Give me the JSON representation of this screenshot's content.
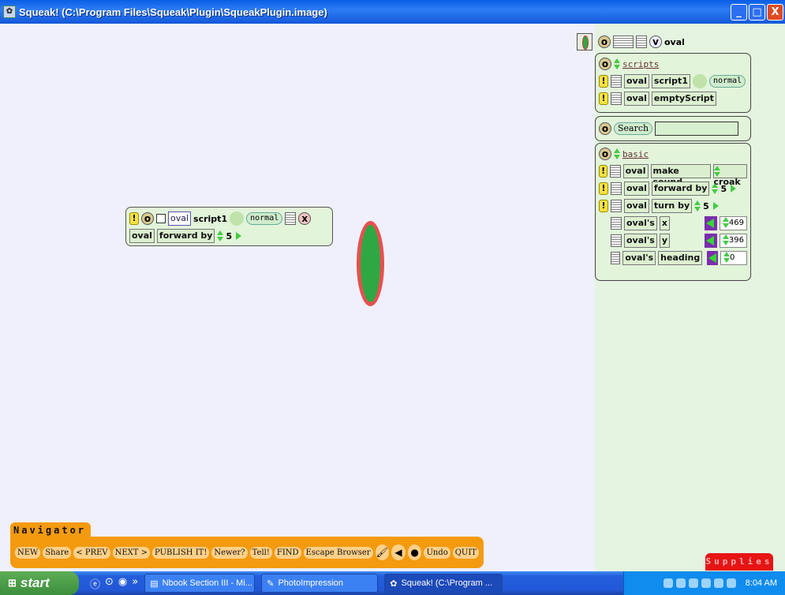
{
  "window": {
    "title": "Squeak! (C:\\Program Files\\Squeak\\Plugin\\SqueakPlugin.image)",
    "minimize": "_",
    "maximize": "□",
    "close": "X"
  },
  "script_editor": {
    "player": "oval",
    "script_name": "script1",
    "tick": "normal",
    "close": "x",
    "line": {
      "player": "oval",
      "command": "forward by",
      "value": "5"
    }
  },
  "viewer": {
    "header": {
      "tab_v": "v",
      "player": "oval"
    },
    "scripts": {
      "category": "scripts",
      "items": [
        {
          "player": "oval",
          "name": "script1",
          "tick": "normal"
        },
        {
          "player": "oval",
          "name": "emptyScript"
        }
      ]
    },
    "search": {
      "label": "Search",
      "value": ""
    },
    "basic": {
      "category": "basic",
      "commands": [
        {
          "player": "oval",
          "command": "make sound",
          "arg": "croak"
        },
        {
          "player": "oval",
          "command": "forward by",
          "arg": "5"
        },
        {
          "player": "oval",
          "command": "turn by",
          "arg": "5"
        }
      ],
      "properties": [
        {
          "owner": "oval's",
          "name": "x",
          "value": "469"
        },
        {
          "owner": "oval's",
          "name": "y",
          "value": "396"
        },
        {
          "owner": "oval's",
          "name": "heading",
          "value": "0"
        }
      ]
    }
  },
  "navigator": {
    "tab": "Navigator",
    "buttons": [
      "NEW",
      "Share",
      "< PREV",
      "NEXT >",
      "PUBLISH IT!",
      "Newer?",
      "Tell!",
      "FIND",
      "Escape Browser"
    ],
    "undo": "Undo",
    "quit": "QUIT"
  },
  "supplies": "Supplies",
  "taskbar": {
    "start": "start",
    "tasks": [
      "Nbook Section III - Mi...",
      "PhotoImpression",
      "Squeak! (C:\\Program ..."
    ],
    "time": "8:04 AM"
  },
  "colors": {
    "oval_fill": "#2fa843",
    "oval_border": "#e65050",
    "navigator": "#f49a0f",
    "supplies": "#e61414"
  }
}
